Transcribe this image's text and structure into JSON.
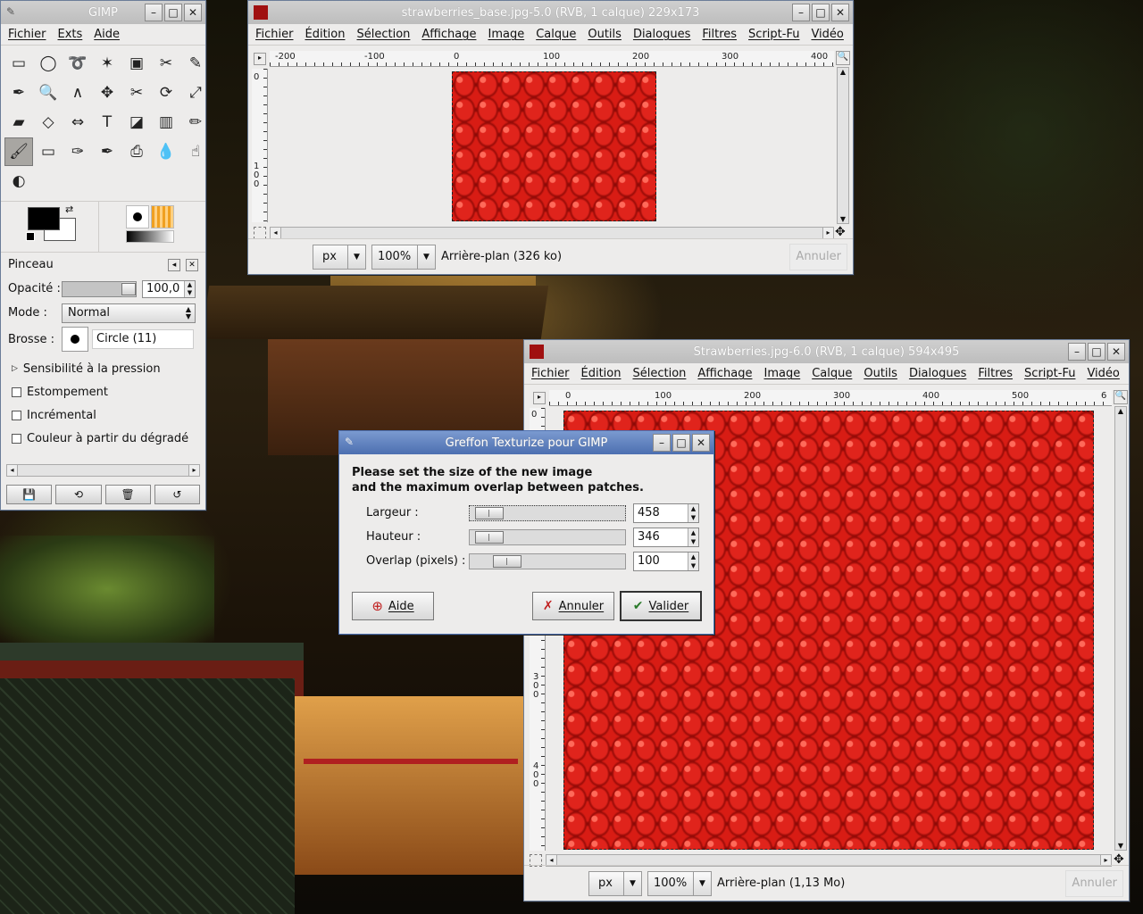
{
  "toolbox": {
    "title": "GIMP",
    "menu": [
      "Fichier",
      "Exts",
      "Aide"
    ],
    "tools": [
      "rect-select-icon",
      "ellipse-select-icon",
      "lasso-icon",
      "fuzzy-select-icon",
      "select-by-color-icon",
      "scissors-icon",
      "paths-icon",
      "color-picker-icon",
      "zoom-icon",
      "measure-icon",
      "move-icon",
      "crop-icon",
      "rotate-icon",
      "scale-icon",
      "shear-icon",
      "perspective-icon",
      "flip-icon",
      "text-icon",
      "bucket-fill-icon",
      "blend-icon",
      "pencil-icon",
      "paintbrush-icon",
      "eraser-icon",
      "airbrush-icon",
      "ink-icon",
      "clone-icon",
      "blur-icon",
      "smudge-icon",
      "dodge-burn-icon"
    ],
    "tool_glyphs": [
      "▭",
      "◯",
      "➰",
      "✶",
      "▣",
      "✂",
      "✎",
      "✒",
      "🔍",
      "∧",
      "✥",
      "✂",
      "⟳",
      "⤢",
      "▰",
      "◇",
      "⇔",
      "T",
      "◪",
      "▥",
      "✏",
      "🖌",
      "▭",
      "✑",
      "✒",
      "⎙",
      "💧",
      "☝",
      "◐"
    ],
    "active_tool_index": 21,
    "panel_title": "Pinceau",
    "opacity_label": "Opacité :",
    "opacity_value": "100,0",
    "opacity_fraction": 1.0,
    "mode_label": "Mode :",
    "mode_value": "Normal",
    "brush_label": "Brosse :",
    "brush_value": "Circle (11)",
    "pressure_label": "Sensibilité à la pression",
    "checks": [
      "Estompement",
      "Incrémental",
      "Couleur à partir du dégradé"
    ]
  },
  "window1": {
    "title": "strawberries_base.jpg-5.0 (RVB, 1 calque) 229x173",
    "menu": [
      "Fichier",
      "Édition",
      "Sélection",
      "Affichage",
      "Image",
      "Calque",
      "Outils",
      "Dialogues",
      "Filtres",
      "Script-Fu",
      "Vidéo"
    ],
    "ruler_h": [
      "-200",
      "-100",
      "0",
      "100",
      "200",
      "300",
      "400"
    ],
    "ruler_v": [
      "0",
      "1",
      "0",
      "0"
    ],
    "unit": "px",
    "zoom": "100%",
    "status": "Arrière-plan (326 ko)",
    "cancel": "Annuler"
  },
  "window2": {
    "title": "Strawberries.jpg-6.0 (RVB, 1 calque) 594x495",
    "menu": [
      "Fichier",
      "Édition",
      "Sélection",
      "Affichage",
      "Image",
      "Calque",
      "Outils",
      "Dialogues",
      "Filtres",
      "Script-Fu",
      "Vidéo"
    ],
    "ruler_h": [
      "0",
      "100",
      "200",
      "300",
      "400",
      "500",
      "6"
    ],
    "ruler_v_300": [
      "3",
      "0",
      "0"
    ],
    "ruler_v_400": [
      "4",
      "0",
      "0"
    ],
    "ruler_v_top": "0",
    "unit": "px",
    "zoom": "100%",
    "status": "Arrière-plan (1,13 Mo)",
    "cancel": "Annuler"
  },
  "dialog": {
    "title": "Greffon Texturize pour GIMP",
    "message_line1": "Please set the size of the new image",
    "message_line2": "and the maximum overlap between patches.",
    "fields": [
      {
        "label": "Largeur :",
        "value": "458"
      },
      {
        "label": "Hauteur :",
        "value": "346"
      },
      {
        "label": "Overlap (pixels) :",
        "value": "100"
      }
    ],
    "help_button": "Aide",
    "cancel_button": "Annuler",
    "ok_button": "Valider"
  }
}
